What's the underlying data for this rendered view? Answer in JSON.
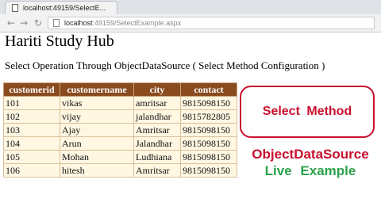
{
  "browser": {
    "tab_title": "localhost:49159/SelectE...",
    "back_icon": "back-arrow-icon",
    "forward_icon": "forward-arrow-icon",
    "reload_icon": "reload-icon",
    "url_host": "localhost",
    "url_rest": ":49159/SelectExample.aspx"
  },
  "page": {
    "title": "Hariti Study Hub",
    "subtitle": "Select Operation Through ObjectDataSource ( Select Method Configuration )"
  },
  "table": {
    "headers": [
      "customerid",
      "customername",
      "city",
      "contact"
    ],
    "rows": [
      [
        "101",
        "vikas",
        "amritsar",
        "9815098150"
      ],
      [
        "102",
        "vijay",
        "jalandhar",
        "9815782805"
      ],
      [
        "103",
        "Ajay",
        "Amritsar",
        "9815098150"
      ],
      [
        "104",
        "Arun",
        "Jalandhar",
        "9815098150"
      ],
      [
        "105",
        "Mohan",
        "Ludhiana",
        "9815098150"
      ],
      [
        "106",
        "hitesh",
        "Amritsar",
        "9815098150"
      ]
    ]
  },
  "overlay": {
    "callout": "Select Method",
    "caption_line1": "ObjectDataSource",
    "caption_line2": "Live Example",
    "accent_red": "#c8102e",
    "accent_green": "#2aa34a",
    "header_brown": "#8a4b1f"
  }
}
